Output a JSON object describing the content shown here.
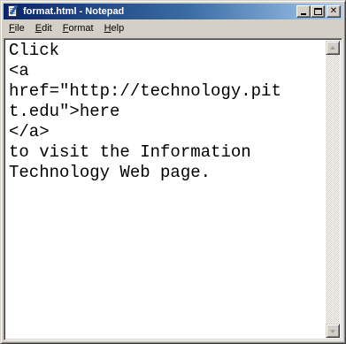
{
  "window": {
    "title": "format.html - Notepad",
    "icon": "notepad-icon",
    "buttons": {
      "minimize": "minimize-icon",
      "maximize": "maximize-icon",
      "close": "✕"
    }
  },
  "menubar": {
    "items": [
      {
        "accel": "F",
        "rest": "ile"
      },
      {
        "accel": "E",
        "rest": "dit"
      },
      {
        "accel": "F",
        "rest": "ormat"
      },
      {
        "accel": "H",
        "rest": "elp"
      }
    ]
  },
  "editor": {
    "lines": [
      "Click",
      "<a",
      "href=\"http://technology.pit",
      "t.edu\">here",
      "</a>",
      "to visit the Information",
      "Technology Web page."
    ]
  },
  "colors": {
    "titlebar_start": "#0a246a",
    "titlebar_end": "#a6caf0",
    "chrome": "#d4d0c8"
  }
}
